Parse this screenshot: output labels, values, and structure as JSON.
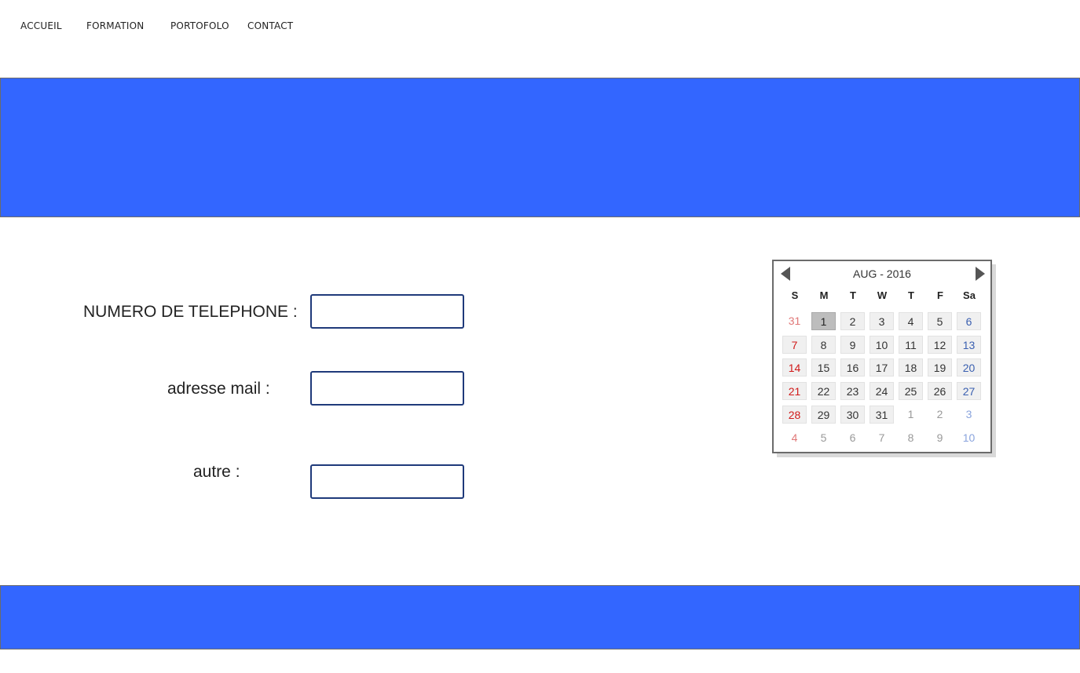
{
  "nav": {
    "items": [
      "ACCUEIL",
      "FORMATION",
      "PORTOFOLO",
      "CONTACT"
    ]
  },
  "colors": {
    "banner": "#3366ff",
    "field_border": "#1f3a7a",
    "sunday": "#d11a1a",
    "saturday": "#3a5fb0"
  },
  "form": {
    "phone_label": "NUMERO DE TELEPHONE :",
    "phone_value": "",
    "email_label": "adresse mail :",
    "email_value": "",
    "other_label": "autre :",
    "other_value": ""
  },
  "calendar": {
    "title": "AUG - 2016",
    "prev_icon": "triangle-left-icon",
    "next_icon": "triangle-right-icon",
    "weekdays": [
      "S",
      "M",
      "T",
      "W",
      "T",
      "F",
      "Sa"
    ],
    "selected_day": "1",
    "weeks": [
      [
        {
          "d": "31",
          "m": "prev"
        },
        {
          "d": "1",
          "m": "cur"
        },
        {
          "d": "2",
          "m": "cur"
        },
        {
          "d": "3",
          "m": "cur"
        },
        {
          "d": "4",
          "m": "cur"
        },
        {
          "d": "5",
          "m": "cur"
        },
        {
          "d": "6",
          "m": "cur"
        }
      ],
      [
        {
          "d": "7",
          "m": "cur"
        },
        {
          "d": "8",
          "m": "cur"
        },
        {
          "d": "9",
          "m": "cur"
        },
        {
          "d": "10",
          "m": "cur"
        },
        {
          "d": "11",
          "m": "cur"
        },
        {
          "d": "12",
          "m": "cur"
        },
        {
          "d": "13",
          "m": "cur"
        }
      ],
      [
        {
          "d": "14",
          "m": "cur"
        },
        {
          "d": "15",
          "m": "cur"
        },
        {
          "d": "16",
          "m": "cur"
        },
        {
          "d": "17",
          "m": "cur"
        },
        {
          "d": "18",
          "m": "cur"
        },
        {
          "d": "19",
          "m": "cur"
        },
        {
          "d": "20",
          "m": "cur"
        }
      ],
      [
        {
          "d": "21",
          "m": "cur"
        },
        {
          "d": "22",
          "m": "cur"
        },
        {
          "d": "23",
          "m": "cur"
        },
        {
          "d": "24",
          "m": "cur"
        },
        {
          "d": "25",
          "m": "cur"
        },
        {
          "d": "26",
          "m": "cur"
        },
        {
          "d": "27",
          "m": "cur"
        }
      ],
      [
        {
          "d": "28",
          "m": "cur"
        },
        {
          "d": "29",
          "m": "cur"
        },
        {
          "d": "30",
          "m": "cur"
        },
        {
          "d": "31",
          "m": "cur"
        },
        {
          "d": "1",
          "m": "next"
        },
        {
          "d": "2",
          "m": "next"
        },
        {
          "d": "3",
          "m": "next"
        }
      ],
      [
        {
          "d": "4",
          "m": "next"
        },
        {
          "d": "5",
          "m": "next"
        },
        {
          "d": "6",
          "m": "next"
        },
        {
          "d": "7",
          "m": "next"
        },
        {
          "d": "8",
          "m": "next"
        },
        {
          "d": "9",
          "m": "next"
        },
        {
          "d": "10",
          "m": "next"
        }
      ]
    ]
  }
}
